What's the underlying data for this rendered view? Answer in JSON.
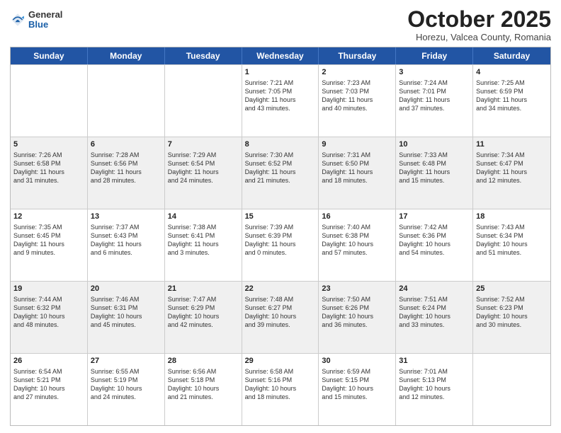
{
  "header": {
    "logo_general": "General",
    "logo_blue": "Blue",
    "month_title": "October 2025",
    "location": "Horezu, Valcea County, Romania"
  },
  "weekdays": [
    "Sunday",
    "Monday",
    "Tuesday",
    "Wednesday",
    "Thursday",
    "Friday",
    "Saturday"
  ],
  "rows": [
    [
      {
        "day": "",
        "text": ""
      },
      {
        "day": "",
        "text": ""
      },
      {
        "day": "",
        "text": ""
      },
      {
        "day": "1",
        "text": "Sunrise: 7:21 AM\nSunset: 7:05 PM\nDaylight: 11 hours\nand 43 minutes."
      },
      {
        "day": "2",
        "text": "Sunrise: 7:23 AM\nSunset: 7:03 PM\nDaylight: 11 hours\nand 40 minutes."
      },
      {
        "day": "3",
        "text": "Sunrise: 7:24 AM\nSunset: 7:01 PM\nDaylight: 11 hours\nand 37 minutes."
      },
      {
        "day": "4",
        "text": "Sunrise: 7:25 AM\nSunset: 6:59 PM\nDaylight: 11 hours\nand 34 minutes."
      }
    ],
    [
      {
        "day": "5",
        "text": "Sunrise: 7:26 AM\nSunset: 6:58 PM\nDaylight: 11 hours\nand 31 minutes."
      },
      {
        "day": "6",
        "text": "Sunrise: 7:28 AM\nSunset: 6:56 PM\nDaylight: 11 hours\nand 28 minutes."
      },
      {
        "day": "7",
        "text": "Sunrise: 7:29 AM\nSunset: 6:54 PM\nDaylight: 11 hours\nand 24 minutes."
      },
      {
        "day": "8",
        "text": "Sunrise: 7:30 AM\nSunset: 6:52 PM\nDaylight: 11 hours\nand 21 minutes."
      },
      {
        "day": "9",
        "text": "Sunrise: 7:31 AM\nSunset: 6:50 PM\nDaylight: 11 hours\nand 18 minutes."
      },
      {
        "day": "10",
        "text": "Sunrise: 7:33 AM\nSunset: 6:48 PM\nDaylight: 11 hours\nand 15 minutes."
      },
      {
        "day": "11",
        "text": "Sunrise: 7:34 AM\nSunset: 6:47 PM\nDaylight: 11 hours\nand 12 minutes."
      }
    ],
    [
      {
        "day": "12",
        "text": "Sunrise: 7:35 AM\nSunset: 6:45 PM\nDaylight: 11 hours\nand 9 minutes."
      },
      {
        "day": "13",
        "text": "Sunrise: 7:37 AM\nSunset: 6:43 PM\nDaylight: 11 hours\nand 6 minutes."
      },
      {
        "day": "14",
        "text": "Sunrise: 7:38 AM\nSunset: 6:41 PM\nDaylight: 11 hours\nand 3 minutes."
      },
      {
        "day": "15",
        "text": "Sunrise: 7:39 AM\nSunset: 6:39 PM\nDaylight: 11 hours\nand 0 minutes."
      },
      {
        "day": "16",
        "text": "Sunrise: 7:40 AM\nSunset: 6:38 PM\nDaylight: 10 hours\nand 57 minutes."
      },
      {
        "day": "17",
        "text": "Sunrise: 7:42 AM\nSunset: 6:36 PM\nDaylight: 10 hours\nand 54 minutes."
      },
      {
        "day": "18",
        "text": "Sunrise: 7:43 AM\nSunset: 6:34 PM\nDaylight: 10 hours\nand 51 minutes."
      }
    ],
    [
      {
        "day": "19",
        "text": "Sunrise: 7:44 AM\nSunset: 6:32 PM\nDaylight: 10 hours\nand 48 minutes."
      },
      {
        "day": "20",
        "text": "Sunrise: 7:46 AM\nSunset: 6:31 PM\nDaylight: 10 hours\nand 45 minutes."
      },
      {
        "day": "21",
        "text": "Sunrise: 7:47 AM\nSunset: 6:29 PM\nDaylight: 10 hours\nand 42 minutes."
      },
      {
        "day": "22",
        "text": "Sunrise: 7:48 AM\nSunset: 6:27 PM\nDaylight: 10 hours\nand 39 minutes."
      },
      {
        "day": "23",
        "text": "Sunrise: 7:50 AM\nSunset: 6:26 PM\nDaylight: 10 hours\nand 36 minutes."
      },
      {
        "day": "24",
        "text": "Sunrise: 7:51 AM\nSunset: 6:24 PM\nDaylight: 10 hours\nand 33 minutes."
      },
      {
        "day": "25",
        "text": "Sunrise: 7:52 AM\nSunset: 6:23 PM\nDaylight: 10 hours\nand 30 minutes."
      }
    ],
    [
      {
        "day": "26",
        "text": "Sunrise: 6:54 AM\nSunset: 5:21 PM\nDaylight: 10 hours\nand 27 minutes."
      },
      {
        "day": "27",
        "text": "Sunrise: 6:55 AM\nSunset: 5:19 PM\nDaylight: 10 hours\nand 24 minutes."
      },
      {
        "day": "28",
        "text": "Sunrise: 6:56 AM\nSunset: 5:18 PM\nDaylight: 10 hours\nand 21 minutes."
      },
      {
        "day": "29",
        "text": "Sunrise: 6:58 AM\nSunset: 5:16 PM\nDaylight: 10 hours\nand 18 minutes."
      },
      {
        "day": "30",
        "text": "Sunrise: 6:59 AM\nSunset: 5:15 PM\nDaylight: 10 hours\nand 15 minutes."
      },
      {
        "day": "31",
        "text": "Sunrise: 7:01 AM\nSunset: 5:13 PM\nDaylight: 10 hours\nand 12 minutes."
      },
      {
        "day": "",
        "text": ""
      }
    ]
  ]
}
